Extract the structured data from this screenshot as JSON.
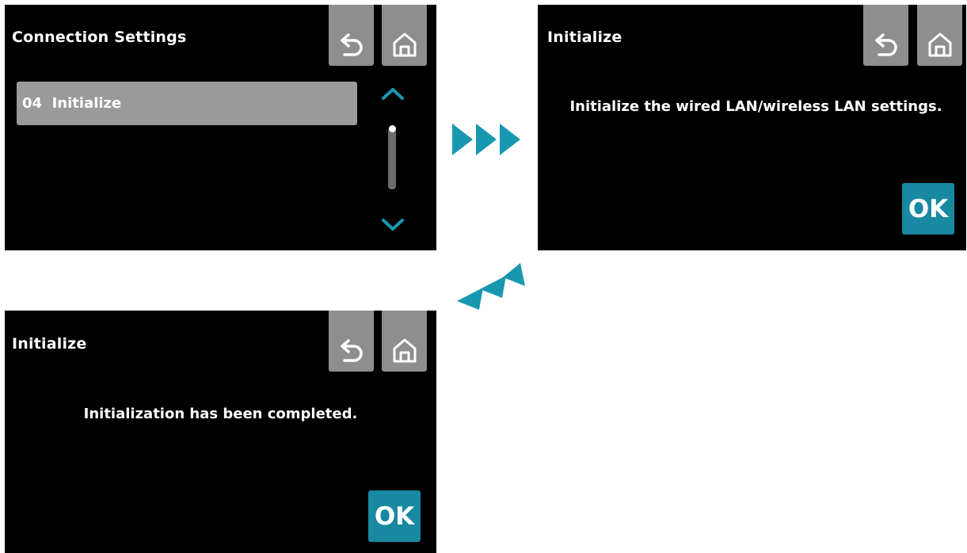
{
  "screens": [
    {
      "title": "Connection Settings",
      "list_item": {
        "number": "04",
        "label": "Initialize"
      },
      "scroll": {
        "position": 0
      }
    },
    {
      "title": "Initialize",
      "message": "Initialize the wired LAN/wireless LAN settings.",
      "ok_label": "OK"
    },
    {
      "title": "Initialize",
      "message": "Initialization has been completed.",
      "ok_label": "OK"
    }
  ],
  "icons": {
    "back": "back-arrow-icon",
    "home": "home-icon",
    "scroll_up": "chevron-up-icon",
    "scroll_down": "chevron-down-icon",
    "flow_next": "triple-triangle-right-icon",
    "flow_back": "triple-triangle-left-icon"
  },
  "colors": {
    "screen_bg": "#000000",
    "nav_button": "#8e8e8e",
    "list_item": "#9a9a9a",
    "accent_teal": "#1889a1",
    "flow_arrow": "#1a97b0",
    "text": "#ffffff"
  }
}
